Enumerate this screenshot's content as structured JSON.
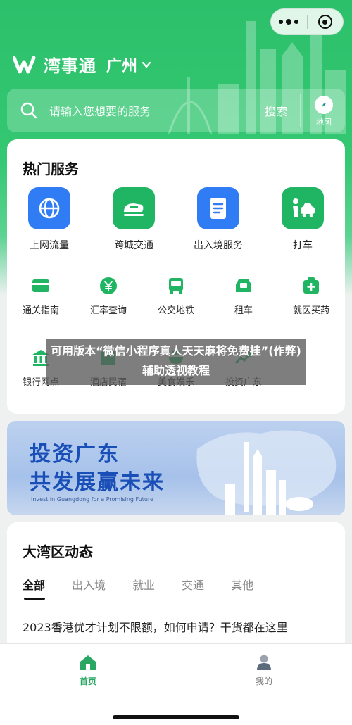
{
  "app": {
    "name": "湾事通",
    "city": "广州"
  },
  "search": {
    "placeholder": "请输入您想要的服务",
    "button_label": "搜索",
    "map_label": "地图"
  },
  "hot_services": {
    "title": "热门服务",
    "primary": [
      {
        "label": "上网流量",
        "icon": "globe-icon",
        "color": "#2f7cf5"
      },
      {
        "label": "跨城交通",
        "icon": "train-icon",
        "color": "#1fb563"
      },
      {
        "label": "出入境服务",
        "icon": "document-icon",
        "color": "#2f7cf5"
      },
      {
        "label": "打车",
        "icon": "taxi-icon",
        "color": "#1fb563"
      }
    ],
    "row2": [
      {
        "label": "通关指南",
        "icon": "card-icon"
      },
      {
        "label": "汇率查询",
        "icon": "yen-icon"
      },
      {
        "label": "公交地铁",
        "icon": "bus-icon"
      },
      {
        "label": "租车",
        "icon": "rental-car-icon"
      },
      {
        "label": "就医买药",
        "icon": "medical-icon"
      }
    ],
    "row3": [
      {
        "label": "银行网点",
        "icon": "bank-icon"
      },
      {
        "label": "酒店民宿",
        "icon": "hotel-icon"
      },
      {
        "label": "美食娱乐",
        "icon": "food-icon"
      },
      {
        "label": "投资广东",
        "icon": "invest-icon"
      }
    ]
  },
  "overlay": {
    "text": "可用版本“微信小程序真人天天麻将免费挂”(作弊)辅助透视教程"
  },
  "banner": {
    "line1": "投资广东",
    "line2": "共发展赢未来",
    "subtitle": "Invest in Guangdong for a Promising Future"
  },
  "news": {
    "title": "大湾区动态",
    "tabs": [
      "全部",
      "出入境",
      "就业",
      "交通",
      "其他"
    ],
    "active_tab": "全部",
    "first_item": "2023香港优才计划不限额，如何申请？干货都在这里"
  },
  "tabbar": {
    "items": [
      {
        "label": "首页",
        "icon": "home-icon",
        "active": true
      },
      {
        "label": "我的",
        "icon": "profile-icon",
        "active": false
      }
    ]
  },
  "colors": {
    "brand_green": "#2cc06b",
    "active_tab_green": "#2aa764",
    "blue_tile": "#2f7cf5",
    "banner_blue": "#1a4fb8"
  }
}
